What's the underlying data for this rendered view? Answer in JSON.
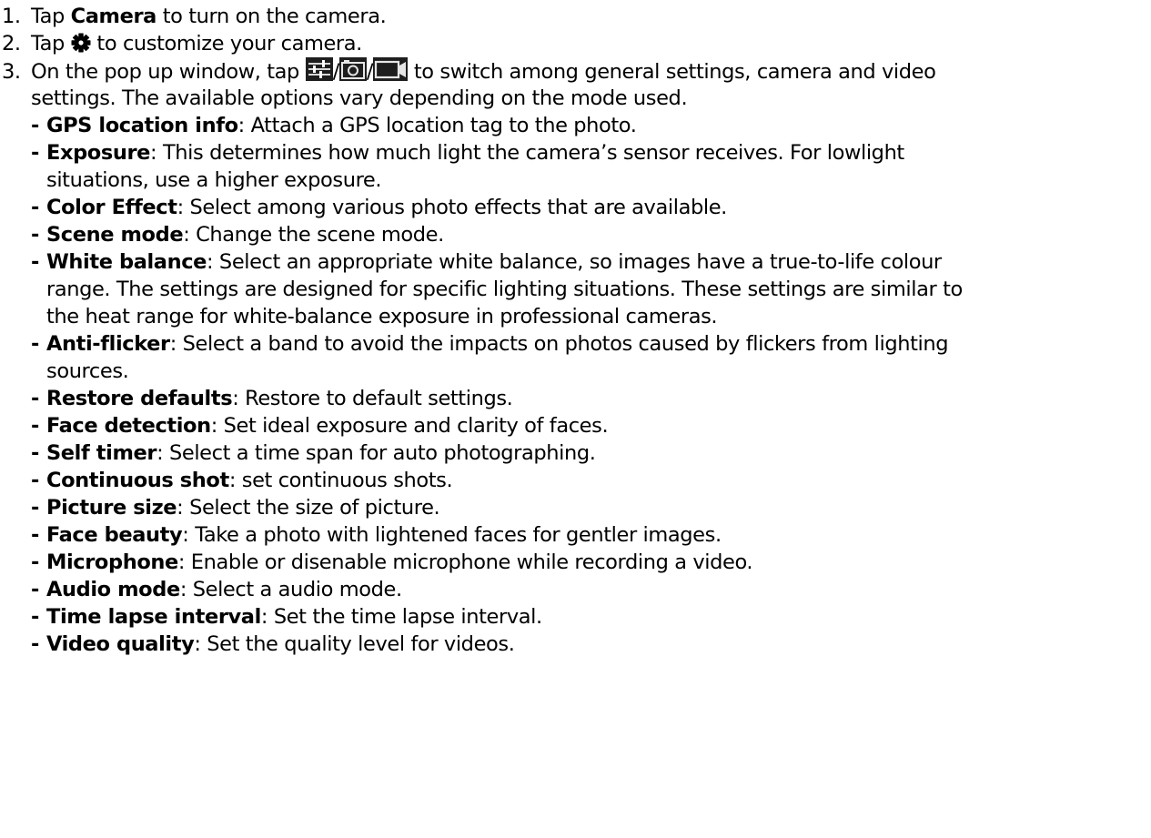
{
  "steps": [
    {
      "num": "1.",
      "pre": "Tap ",
      "bold": "Camera",
      "post": " to turn on the camera."
    },
    {
      "num": "2.",
      "pre": "Tap ",
      "post": " to customize your camera."
    },
    {
      "num": "3.",
      "pre": "On the pop up window, tap ",
      "sep1": "/",
      "sep2": "/",
      "post": " to switch among general settings, camera and video",
      "cont": "settings. The available options vary depending on the mode used."
    }
  ],
  "options": [
    {
      "term": "GPS location info",
      "desc": ": Attach a GPS location tag to the photo.",
      "cont": []
    },
    {
      "term": "Exposure",
      "desc": ": This determines how much light the camera’s sensor receives. For lowlight",
      "cont": [
        "situations, use a higher exposure."
      ]
    },
    {
      "term": "Color Effect",
      "desc": ": Select among various photo effects that are available.",
      "cont": []
    },
    {
      "term": "Scene mode",
      "desc": ": Change the scene mode.",
      "cont": []
    },
    {
      "term": "White balance",
      "desc": ": Select an appropriate white balance, so images have a true-to-life colour",
      "cont": [
        "range. The settings are designed for specific lighting situations. These settings are similar to",
        "the heat range for white-balance exposure in professional cameras."
      ]
    },
    {
      "term": "Anti-flicker",
      "desc": ": Select a band to avoid the impacts on photos caused by flickers from lighting",
      "cont": [
        "sources."
      ]
    },
    {
      "term": "Restore defaults",
      "desc": ": Restore to default settings.",
      "cont": []
    },
    {
      "term": "Face detection",
      "desc": ": Set ideal exposure and clarity of faces.",
      "cont": []
    },
    {
      "term": "Self timer",
      "desc": ": Select a time span for auto photographing.",
      "cont": []
    },
    {
      "term": "Continuous shot",
      "desc": ": set continuous shots.",
      "cont": []
    },
    {
      "term": "Picture size",
      "desc": ": Select the size of picture.",
      "cont": []
    },
    {
      "term": "Face beauty",
      "desc": ": Take a photo with lightened faces for gentler images.",
      "cont": []
    },
    {
      "term": "Microphone",
      "desc": ": Enable or disenable microphone while recording a video.",
      "cont": []
    },
    {
      "term": "Audio mode",
      "desc": ": Select a audio mode.",
      "cont": []
    },
    {
      "term": "Time lapse interval",
      "desc": ": Set the time lapse interval.",
      "cont": []
    },
    {
      "term": "Video quality",
      "desc": ": Set the quality level for videos.",
      "cont": []
    }
  ],
  "icons": {
    "settings": "gear-icon",
    "general": "sliders-icon",
    "camera": "camera-icon",
    "video": "video-camera-icon"
  }
}
